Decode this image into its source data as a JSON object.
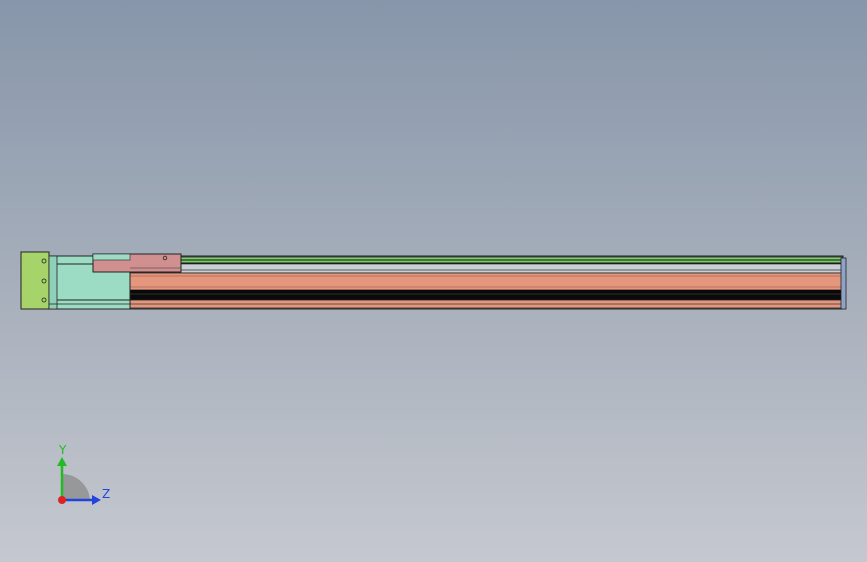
{
  "viewport": {
    "background_top": "#8796aa",
    "background_bottom": "#c5c8cf"
  },
  "model": {
    "end_plate_color": "#a6d46a",
    "motor_housing_color": "#9ddcc4",
    "carriage_color": "#d09090",
    "rail_color": "#e5977e",
    "top_rail_color": "#7ccf6d",
    "groove_color": "#0a0a0a",
    "outline_color": "#222222",
    "end_cap_color": "#8fa3c8"
  },
  "triad": {
    "y_label": "Y",
    "z_label": "Z",
    "y_color": "#22bb22",
    "z_color": "#2244dd",
    "x_color": "#dd2222",
    "icons": [
      "y-axis-arrow-icon",
      "z-axis-arrow-icon",
      "x-axis-dot-icon"
    ]
  }
}
